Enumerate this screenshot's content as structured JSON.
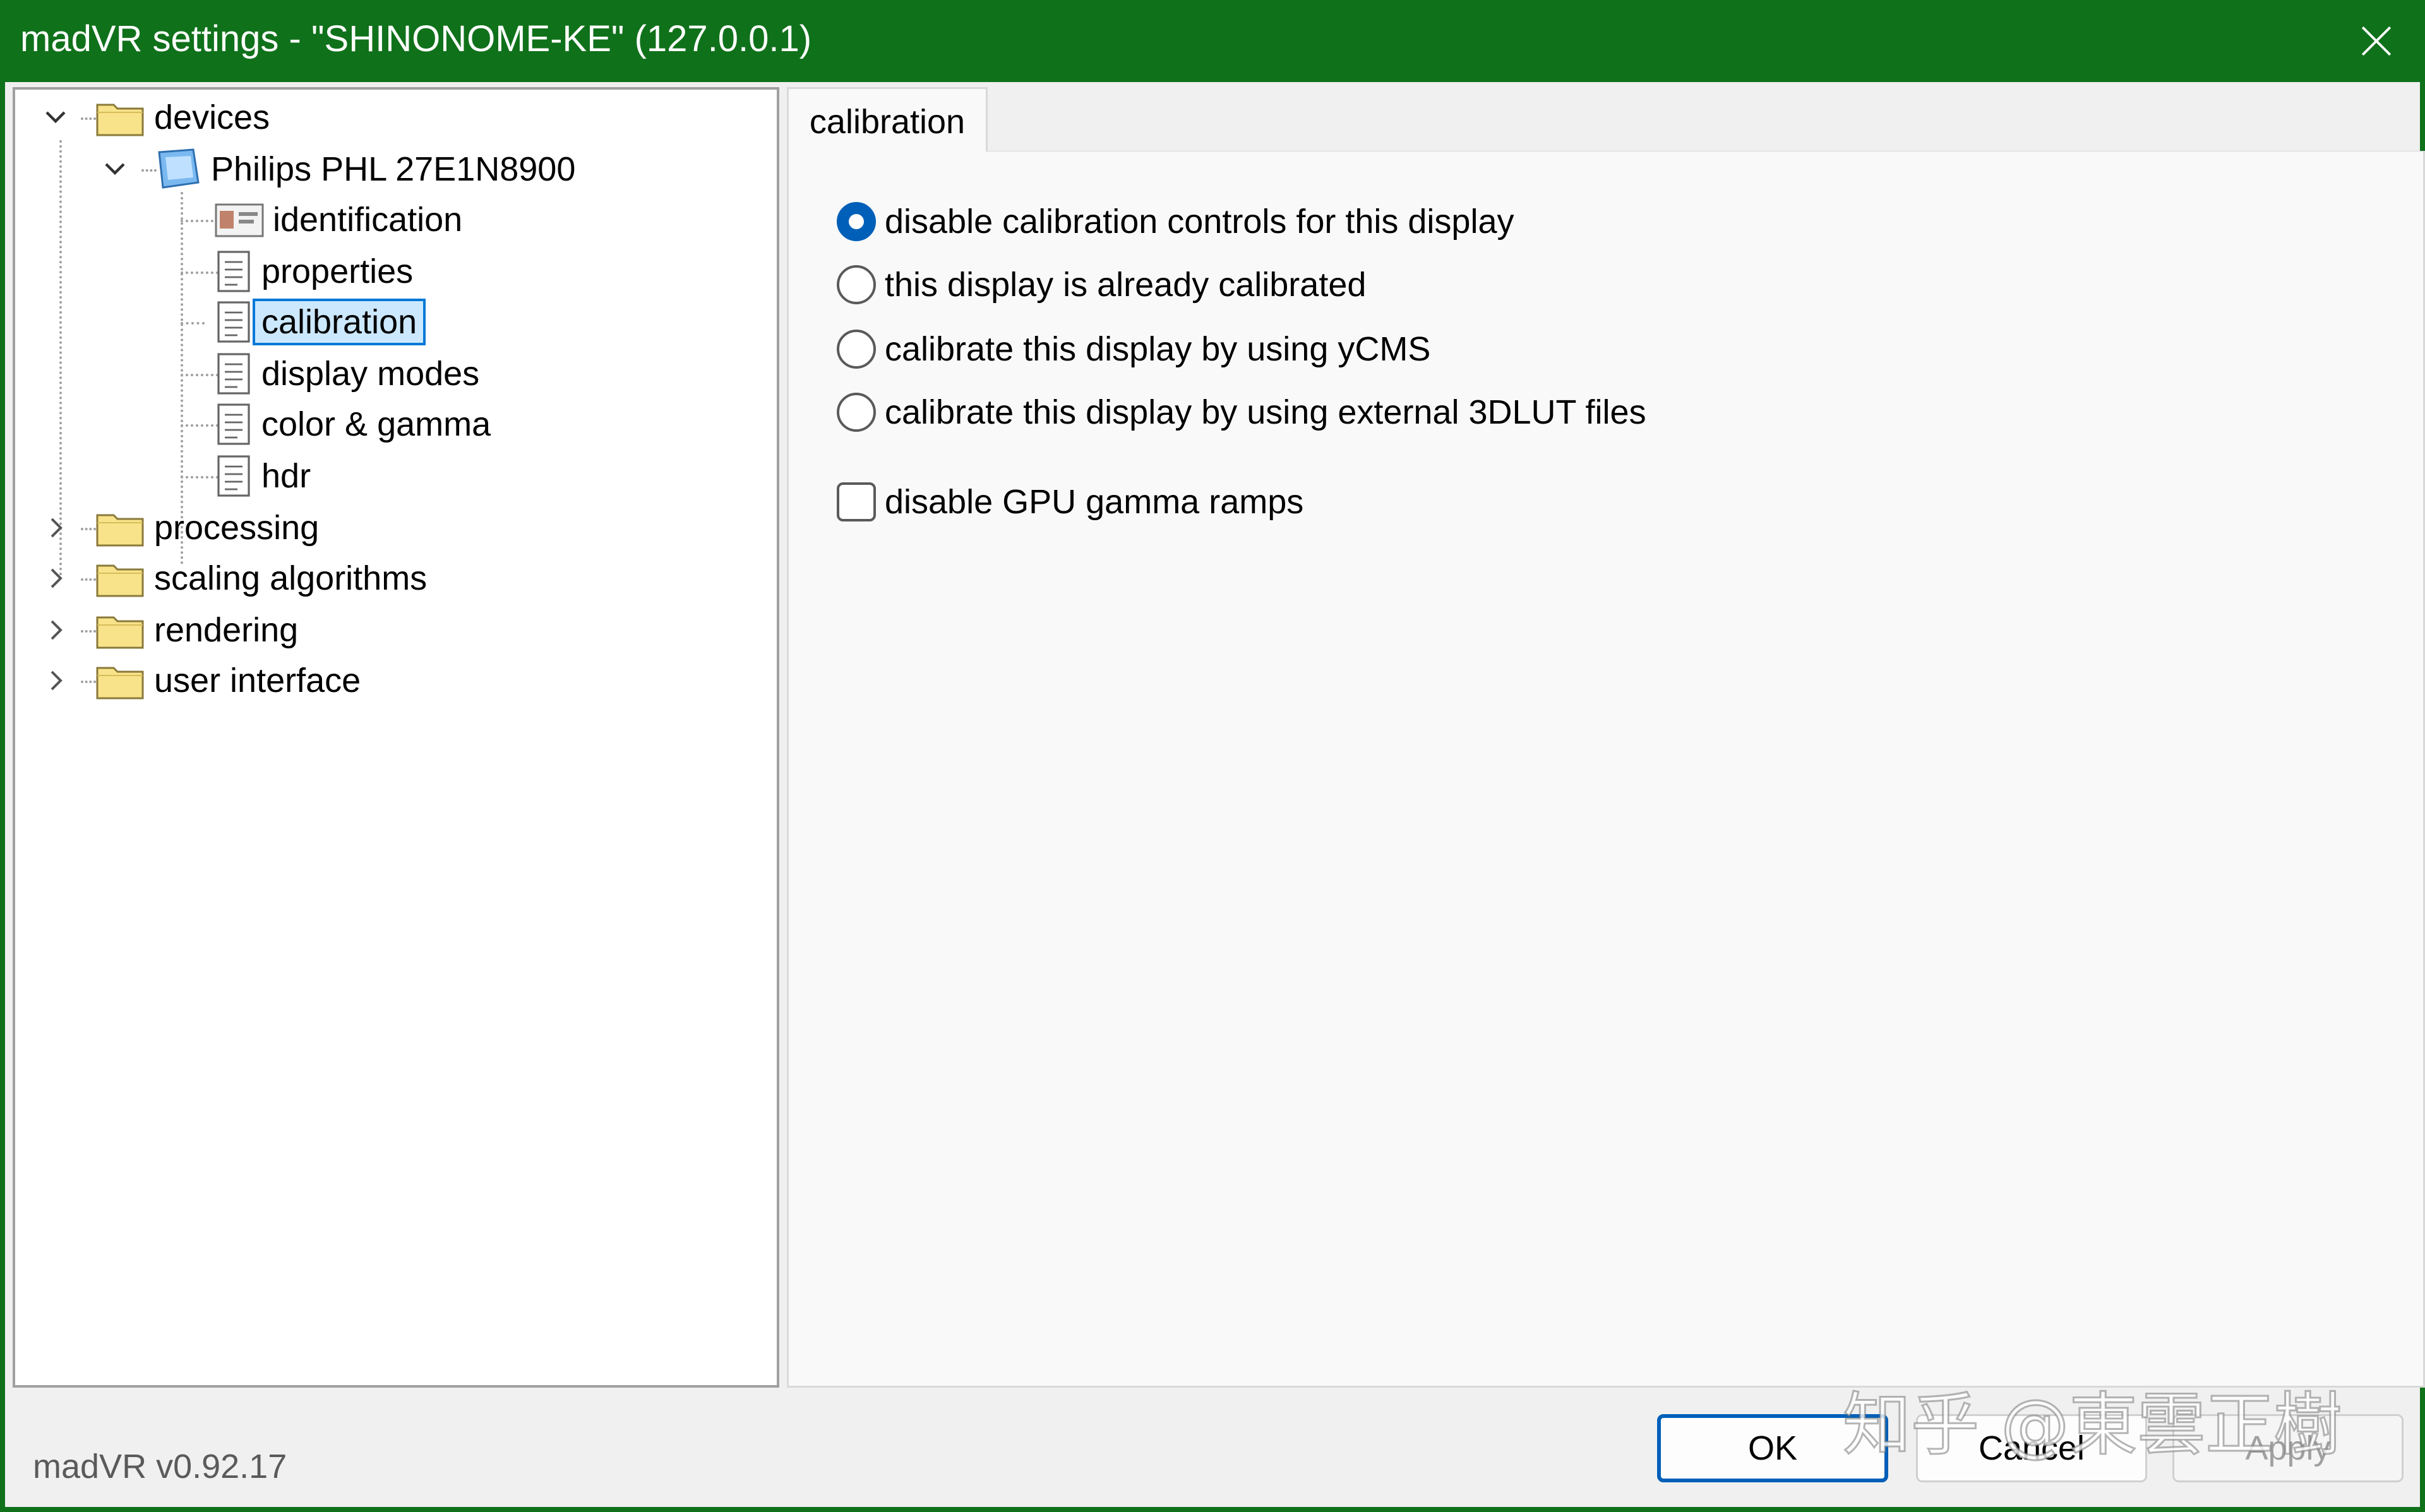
{
  "window": {
    "title": "madVR settings - \"SHINONOME-KE\" (127.0.0.1)",
    "accent_color": "#10711b",
    "close_icon": "close-icon"
  },
  "tree": {
    "devices": "devices",
    "display": "Philips PHL 27E1N8900",
    "children": {
      "identification": "identification",
      "properties": "properties",
      "calibration": "calibration",
      "display_modes": "display modes",
      "color_gamma": "color & gamma",
      "hdr": "hdr"
    },
    "processing": "processing",
    "scaling": "scaling algorithms",
    "rendering": "rendering",
    "user_interface": "user interface"
  },
  "tab": {
    "label": "calibration"
  },
  "options": {
    "radio_disable": "disable calibration controls for this display",
    "radio_already": "this display is already calibrated",
    "radio_ycms": "calibrate this display by using yCMS",
    "radio_3dlut": "calibrate this display by using external 3DLUT files",
    "checkbox_gpu": "disable GPU gamma ramps",
    "selected": "disable calibration controls for this display"
  },
  "footer": {
    "version": "madVR v0.92.17",
    "ok": "OK",
    "cancel": "Cancel",
    "apply": "Apply",
    "watermark": "知乎 @東雲正樹"
  }
}
